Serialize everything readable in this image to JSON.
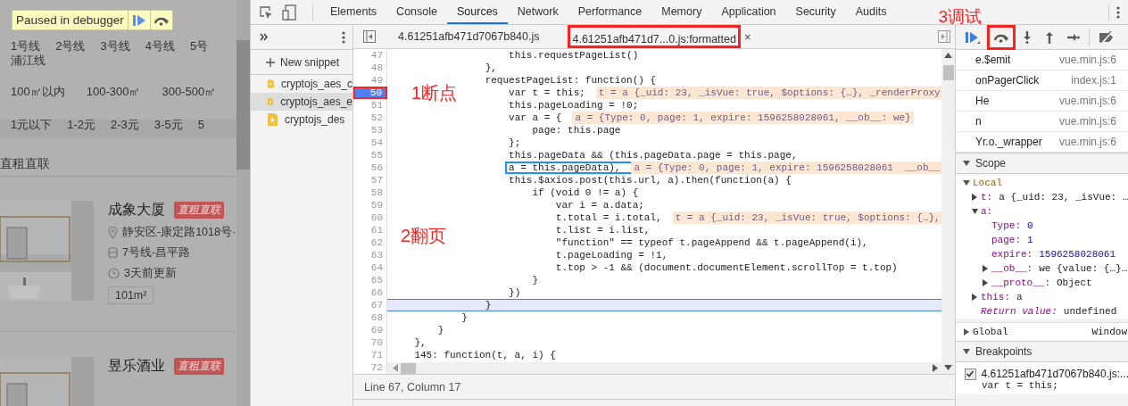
{
  "page": {
    "paused_banner": {
      "label": "Paused in debugger"
    },
    "filter_rows": [
      [
        "1号线",
        "2号线",
        "3号线",
        "4号线",
        "5号"
      ],
      [
        "浦江线"
      ],
      [
        "100㎡以内",
        "100-300㎡",
        "300-500㎡"
      ],
      [
        "1元以下",
        "1-2元",
        "2-3元",
        "3-5元",
        "5"
      ]
    ],
    "section_title": "直租直联",
    "listings": [
      {
        "title": "成象大厦",
        "tag": "直租直联",
        "address": "静安区-康定路1018号·",
        "metro": "7号线-昌平路",
        "updated": "3天前更新",
        "area": "101m²"
      },
      {
        "title": "昱乐酒业",
        "tag": "直租直联"
      }
    ]
  },
  "devtools": {
    "tabs": [
      {
        "label": "Elements",
        "selected": false
      },
      {
        "label": "Console",
        "selected": false
      },
      {
        "label": "Sources",
        "selected": true
      },
      {
        "label": "Network",
        "selected": false
      },
      {
        "label": "Performance",
        "selected": false
      },
      {
        "label": "Memory",
        "selected": false
      },
      {
        "label": "Application",
        "selected": false
      },
      {
        "label": "Security",
        "selected": false
      },
      {
        "label": "Audits",
        "selected": false
      }
    ],
    "navigator": {
      "new_snippet": "New snippet",
      "files": [
        {
          "name": "cryptojs_aes_c",
          "selected": false
        },
        {
          "name": "cryptojs_aes_e",
          "selected": true
        },
        {
          "name": "cryptojs_des",
          "selected": false
        }
      ]
    },
    "editor_tabs": [
      {
        "label": "4.61251afb471d7067b840.js",
        "selected": false,
        "annotated": false
      },
      {
        "label": "4.61251afb471d7...0.js:formatted",
        "selected": true,
        "annotated": true,
        "close": "×"
      }
    ],
    "code": [
      {
        "n": "47",
        "text": "                    this.requestPageList()"
      },
      {
        "n": "48",
        "text": "                },"
      },
      {
        "n": "49",
        "text": "                requestPageList: function() {"
      },
      {
        "n": "50",
        "text": "                    var t = this;",
        "inline": "t = a {_uid: 23, _isVue: true, $options: {…}, _renderProxy",
        "breakpoint": true,
        "annotated": true
      },
      {
        "n": "51",
        "text": "                    this.pageLoading = !0;"
      },
      {
        "n": "52",
        "text": "                    var a = {",
        "inline": "a = {Type: 0, page: 1, expire: 1596258028061, __ob__: we}"
      },
      {
        "n": "53",
        "text": "                        page: this.page"
      },
      {
        "n": "54",
        "text": "                    };"
      },
      {
        "n": "55",
        "text": "                    this.pageData && (this.pageData.page = this.page,"
      },
      {
        "n": "56",
        "text": "                    a = this.pageData),",
        "inline": "a = {Type: 0, page: 1, expire: 1596258028061  __ob__",
        "boxed": true
      },
      {
        "n": "57",
        "text": "                    this.$axios.post(this.url, a).then(function(a) {"
      },
      {
        "n": "58",
        "text": "                        if (void 0 != a) {"
      },
      {
        "n": "59",
        "text": "                            var i = a.data;"
      },
      {
        "n": "60",
        "text": "                            t.total = i.total,",
        "inline": "t = a {_uid: 23, _isVue: true, $options: {…},"
      },
      {
        "n": "61",
        "text": "                            t.list = i.list,"
      },
      {
        "n": "62",
        "text": "                            \"function\" == typeof t.pageAppend && t.pageAppend(i),"
      },
      {
        "n": "63",
        "text": "                            t.pageLoading = !1,"
      },
      {
        "n": "64",
        "text": "                            t.top > -1 && (document.documentElement.scrollTop = t.top)"
      },
      {
        "n": "65",
        "text": "                        }"
      },
      {
        "n": "66",
        "text": "                    })"
      },
      {
        "n": "67",
        "text": "                }",
        "current": true
      },
      {
        "n": "68",
        "text": "            }"
      },
      {
        "n": "69",
        "text": "        }"
      },
      {
        "n": "70",
        "text": "    },"
      },
      {
        "n": "71",
        "text": "    145: function(t, a, i) {"
      },
      {
        "n": "72"
      }
    ],
    "status": "Line 67, Column 17",
    "debug_toolbar": {
      "step_over_annotated": true
    },
    "call_stack": [
      {
        "name": "e.$emit",
        "location": "vue.min.js:6"
      },
      {
        "name": "onPagerClick",
        "location": "index.js:1"
      },
      {
        "name": "He",
        "location": "vue.min.js:6"
      },
      {
        "name": "n",
        "location": "vue.min.js:6"
      },
      {
        "name": "Yr.o._wrapper",
        "location": "vue.min.js:6"
      }
    ],
    "scope": {
      "title": "Scope",
      "expanded": true,
      "sections": [
        {
          "name": "Local",
          "expanded": true,
          "entries": [
            {
              "kind": "object",
              "key": "t:",
              "value": "a {_uid: 23, _isVue: …",
              "expanded": false
            },
            {
              "kind": "object",
              "key": "a:",
              "expanded": true,
              "children": [
                {
                  "kind": "leaf",
                  "key": "Type:",
                  "value": "0"
                },
                {
                  "kind": "leaf",
                  "key": "page:",
                  "value": "1"
                },
                {
                  "kind": "leaf",
                  "key": "expire:",
                  "value": "1596258028061"
                },
                {
                  "kind": "object",
                  "key": "__ob__:",
                  "value": "we {value: {…}…",
                  "expanded": false
                },
                {
                  "kind": "object",
                  "key": "__proto__:",
                  "value": "Object",
                  "expanded": false
                }
              ]
            },
            {
              "kind": "object",
              "key": "this:",
              "value": "a",
              "expanded": false
            },
            {
              "kind": "return",
              "key": "Return value:",
              "value": "undefined"
            }
          ]
        },
        {
          "name": "Global",
          "value": "Window",
          "expanded": false
        }
      ]
    },
    "breakpoints": {
      "title": "Breakpoints",
      "expanded": true,
      "items": [
        {
          "file": "4.61251afb471d7067b840.js:...",
          "code": "var t = this;",
          "checked": true
        }
      ]
    }
  },
  "annotations": [
    {
      "label": "1断点"
    },
    {
      "label": "2翻页"
    },
    {
      "label": "3调试"
    }
  ]
}
